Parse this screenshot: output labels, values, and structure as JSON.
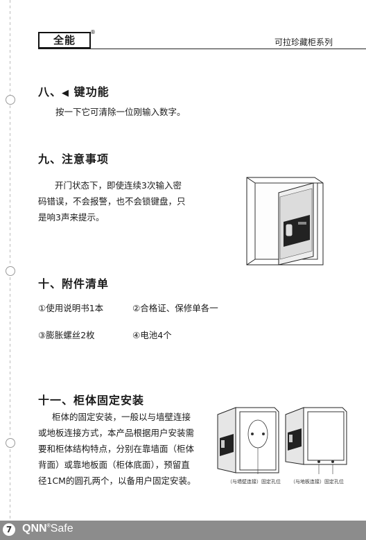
{
  "header": {
    "logo_text": "全能",
    "logo_mark": "®",
    "series": "可拉珍藏柜系列"
  },
  "sections": {
    "s8": {
      "title_prefix": "八、",
      "key_icon": "◀",
      "title_suffix": " 键功能",
      "body": "按一下它可清除一位刚输入数字。"
    },
    "s9": {
      "title": "九、注意事项",
      "lines": [
        "开门状态下，即使连续3次输入密",
        "码错误，不会报警，也不会锁键盘，只",
        "是响3声来提示。"
      ]
    },
    "s10": {
      "title": "十、附件清单",
      "items": [
        "①使用说明书1本",
        "②合格证、保修单各一",
        "③膨胀螺丝2枚",
        "④电池4个"
      ]
    },
    "s11": {
      "title": "十一、柜体固定安装",
      "lines": [
        "柜体的固定安装，一般以与墙壁连接",
        "或地板连接方式，本产品根据用户安装需",
        "要和柜体结构特点，分别在靠墙面（柜体",
        "背面）或靠地板面（柜体底面），预留直",
        "径1CM的圆孔两个，以备用户固定安装。"
      ],
      "caption_wall": "（与墙壁连接）固定孔位",
      "caption_floor": "（与地板连接）固定孔位"
    }
  },
  "footer": {
    "page": "7",
    "brand": "QNN",
    "brand_mark": "®",
    "brand_suffix": "Safe"
  }
}
